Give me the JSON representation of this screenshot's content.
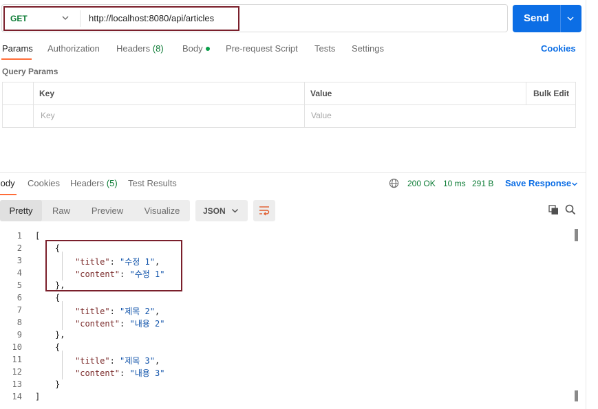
{
  "request": {
    "method": "GET",
    "url": "http://localhost:8080/api/articles",
    "send_label": "Send"
  },
  "request_tabs": [
    {
      "label": "Params"
    },
    {
      "label": "Authorization"
    },
    {
      "label": "Headers",
      "count": "(8)"
    },
    {
      "label": "Body"
    },
    {
      "label": "Pre-request Script"
    },
    {
      "label": "Tests"
    },
    {
      "label": "Settings"
    }
  ],
  "cookies_label": "Cookies",
  "query_params": {
    "title": "Query Params",
    "headers": {
      "key": "Key",
      "value": "Value",
      "bulk_edit": "Bulk Edit"
    },
    "placeholders": {
      "key": "Key",
      "value": "Value"
    }
  },
  "response_tabs": [
    {
      "label": "Body"
    },
    {
      "label": "Cookies"
    },
    {
      "label": "Headers",
      "count": "(5)"
    },
    {
      "label": "Test Results"
    }
  ],
  "response_status": {
    "status": "200 OK",
    "time": "10 ms",
    "size": "291 B",
    "save_label": "Save Response"
  },
  "view_modes": [
    {
      "label": "Pretty"
    },
    {
      "label": "Raw"
    },
    {
      "label": "Preview"
    },
    {
      "label": "Visualize"
    }
  ],
  "format_label": "JSON",
  "colors": {
    "send_button": "#0c6ee5",
    "method_get": "#0a7a33",
    "active_tab_underline": "#ff6c37",
    "highlight_box": "#7a1f2b",
    "json_key": "#7a2a2a",
    "json_string": "#0b4fa8"
  },
  "icons": {
    "method_dropdown": "chevron-down-icon",
    "send_dropdown": "chevron-down-icon",
    "network": "globe-icon",
    "save_dropdown": "chevron-down-icon",
    "format_dropdown": "chevron-down-icon",
    "wrap": "wrap-lines-icon",
    "copy": "copy-icon",
    "search": "search-icon"
  },
  "code": {
    "line_numbers": [
      "1",
      "2",
      "3",
      "4",
      "5",
      "6",
      "7",
      "8",
      "9",
      "10",
      "11",
      "12",
      "13",
      "14"
    ],
    "open_array": "[",
    "close_array": "]",
    "open_obj": "{",
    "close_obj_comma": "},",
    "close_obj": "}",
    "items": [
      {
        "title_key": "\"title\"",
        "title_value": "\"수정 1\"",
        "content_key": "\"content\"",
        "content_value": "\"수정 1\""
      },
      {
        "title_key": "\"title\"",
        "title_value": "\"제목 2\"",
        "content_key": "\"content\"",
        "content_value": "\"내용 2\""
      },
      {
        "title_key": "\"title\"",
        "title_value": "\"제목 3\"",
        "content_key": "\"content\"",
        "content_value": "\"내용 3\""
      }
    ]
  }
}
